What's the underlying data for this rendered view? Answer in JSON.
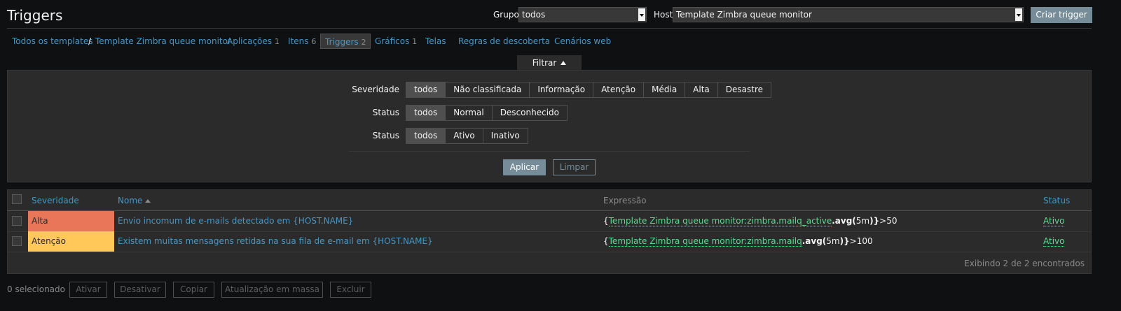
{
  "header": {
    "title": "Triggers",
    "group_label": "Grupo",
    "group_value": "todos",
    "host_label": "Host",
    "host_value": "Template Zimbra queue monitor",
    "create_button": "Criar trigger"
  },
  "breadcrumb": {
    "all_templates": "Todos os templates",
    "separator": "/",
    "template": "Template Zimbra queue monitor"
  },
  "nav": [
    {
      "label": "Aplicações",
      "count": "1"
    },
    {
      "label": "Itens",
      "count": "6"
    },
    {
      "label": "Triggers",
      "count": "2"
    },
    {
      "label": "Gráficos",
      "count": "1"
    },
    {
      "label": "Telas",
      "count": ""
    },
    {
      "label": "Regras de descoberta",
      "count": ""
    },
    {
      "label": "Cenários web",
      "count": ""
    }
  ],
  "filter": {
    "tab_label": "Filtrar",
    "severity_label": "Severidade",
    "severity_options": [
      "todos",
      "Não classificada",
      "Informação",
      "Atenção",
      "Média",
      "Alta",
      "Desastre"
    ],
    "severity_selected": "todos",
    "status1_label": "Status",
    "status1_options": [
      "todos",
      "Normal",
      "Desconhecido"
    ],
    "status2_label": "Status",
    "status2_options": [
      "todos",
      "Ativo",
      "Inativo"
    ],
    "apply_button": "Aplicar",
    "clear_button": "Limpar"
  },
  "table": {
    "columns": {
      "severity": "Severidade",
      "name": "Nome",
      "expression": "Expressão",
      "status": "Status"
    },
    "rows": [
      {
        "severity": "Alta",
        "name": "Envio incomum de e-mails detectado em {HOST.NAME}",
        "expr_open": "{",
        "expr_item": "Template Zimbra queue monitor:zimbra.mailq_active",
        "expr_func": ".avg(",
        "expr_arg": "5m",
        "expr_close": ")}",
        "expr_tail": ">50",
        "status": "Ativo"
      },
      {
        "severity": "Atenção",
        "name": "Existem muitas mensagens retidas na sua fila de e-mail em {HOST.NAME}",
        "expr_open": "{",
        "expr_item": "Template Zimbra queue monitor:zimbra.mailq",
        "expr_func": ".avg(",
        "expr_arg": "5m",
        "expr_close": ")}",
        "expr_tail": ">100",
        "status": "Ativo"
      }
    ],
    "footer": "Exibindo 2 de 2 encontrados"
  },
  "actions": {
    "selected": "0 selecionado",
    "buttons": [
      "Ativar",
      "Desativar",
      "Copiar",
      "Atualização em massa",
      "Excluir"
    ]
  },
  "colors": {
    "severity_alta": "#e97659",
    "severity_atencao": "#ffc859",
    "link": "#4796c4",
    "enabled": "#59db8f"
  }
}
